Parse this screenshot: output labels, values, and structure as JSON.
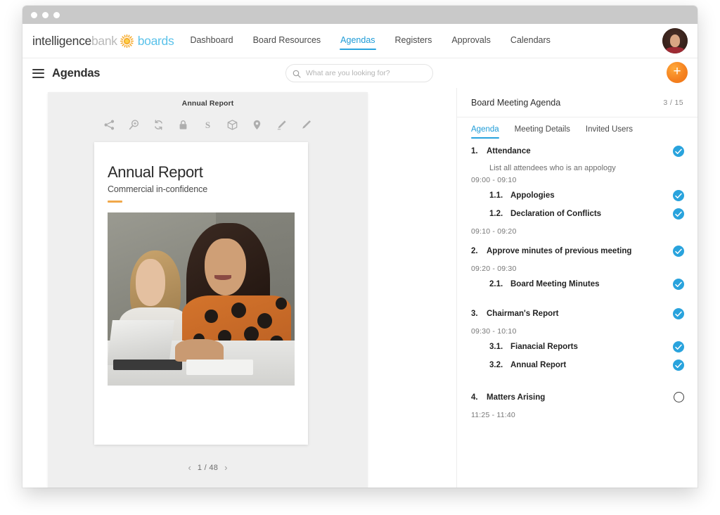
{
  "window": {
    "dots": [
      "close",
      "minimize",
      "maximize"
    ]
  },
  "brand": {
    "part1": "intelligence",
    "part2": "bank",
    "part3": "boards",
    "sun_icon": "sun-icon",
    "sun_color": "#f5a623",
    "boards_color": "#5bc2ea"
  },
  "nav": {
    "items": [
      {
        "label": "Dashboard",
        "active": false
      },
      {
        "label": "Board Resources",
        "active": false
      },
      {
        "label": "Agendas",
        "active": true
      },
      {
        "label": "Registers",
        "active": false
      },
      {
        "label": "Approvals",
        "active": false
      },
      {
        "label": "Calendars",
        "active": false
      }
    ],
    "avatar_name": "user-avatar"
  },
  "pagebar": {
    "menu_icon": "hamburger-menu-icon",
    "title": "Agendas",
    "search": {
      "icon": "search-icon",
      "placeholder": "What are you looking for?",
      "value": ""
    },
    "fab_label": "+",
    "fab_color": "#f58220"
  },
  "viewer": {
    "doc_title": "Annual Report",
    "tools": [
      {
        "name": "share-icon",
        "label": "Share"
      },
      {
        "name": "zoom-in-icon",
        "label": "Zoom"
      },
      {
        "name": "refresh-icon",
        "label": "Refresh"
      },
      {
        "name": "lock-icon",
        "label": "Lock"
      },
      {
        "name": "strikethrough-icon",
        "label": "Strikethrough"
      },
      {
        "name": "box-icon",
        "label": "Package"
      },
      {
        "name": "location-pin-icon",
        "label": "Pin"
      },
      {
        "name": "highlighter-icon",
        "label": "Highlight"
      },
      {
        "name": "pen-icon",
        "label": "Draw"
      }
    ],
    "cover": {
      "heading": "Annual Report",
      "subheading": "Commercial in-confidence",
      "accent_color": "#f0a84a",
      "photo_alt": "two women working at a desk with laptop"
    },
    "pager": {
      "prev": "‹",
      "next": "›",
      "label": "1 / 48",
      "current": 1,
      "total": 48
    }
  },
  "panel": {
    "title": "Board Meeting Agenda",
    "count": "3 / 15",
    "tabs": [
      {
        "label": "Agenda",
        "active": true
      },
      {
        "label": "Meeting Details",
        "active": false
      },
      {
        "label": "Invited Users",
        "active": false
      }
    ],
    "check_color": "#29a3dd",
    "items": [
      {
        "num": "1.",
        "label": "Attendance",
        "checked": true,
        "desc": "List all attendees who is an appology",
        "time": "09:00 - 09:10",
        "children": [
          {
            "num": "1.1.",
            "label": "Appologies",
            "checked": true
          },
          {
            "num": "1.2.",
            "label": "Declaration of Conflicts",
            "checked": true
          }
        ],
        "child_time": "09:10 - 09:20"
      },
      {
        "num": "2.",
        "label": "Approve minutes of previous meeting",
        "checked": true,
        "time": "09:20 - 09:30",
        "children": [
          {
            "num": "2.1.",
            "label": "Board Meeting Minutes",
            "checked": true
          }
        ]
      },
      {
        "num": "3.",
        "label": "Chairman's Report",
        "checked": true,
        "time": "09:30 - 10:10",
        "children": [
          {
            "num": "3.1.",
            "label": "Fianacial Reports",
            "checked": true
          },
          {
            "num": "3.2.",
            "label": "Annual Report",
            "checked": true
          }
        ]
      },
      {
        "num": "4.",
        "label": "Matters Arising",
        "checked": false,
        "time": "11:25 - 11:40",
        "children": []
      }
    ]
  }
}
